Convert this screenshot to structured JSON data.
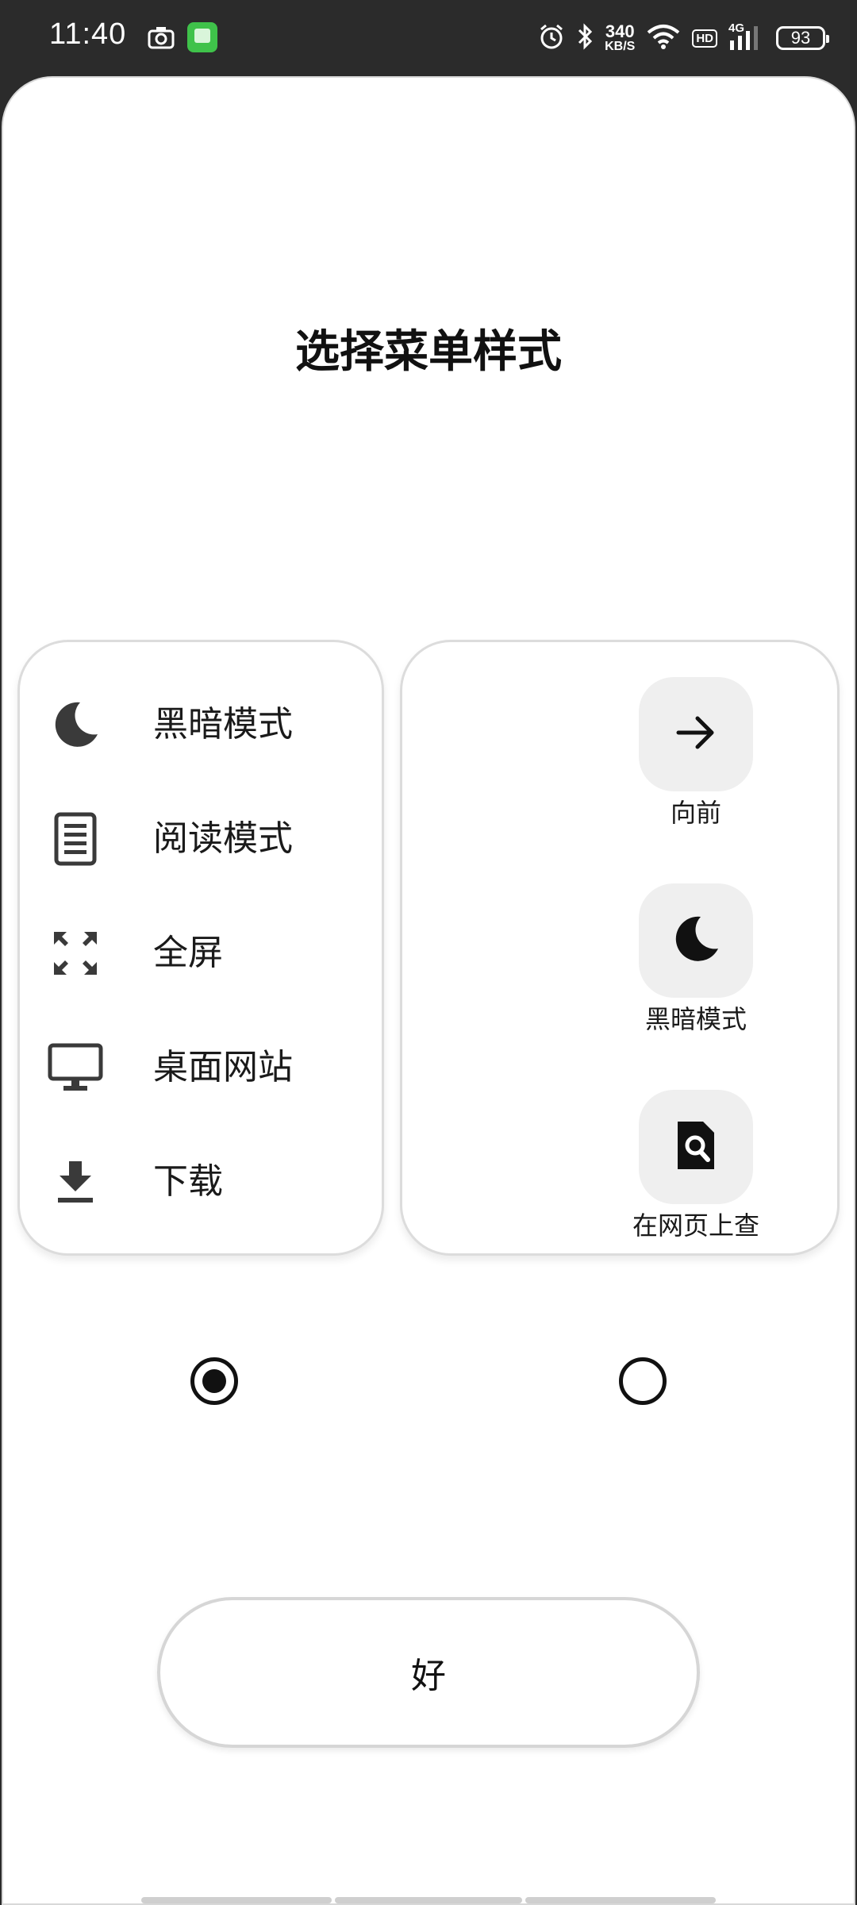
{
  "status_bar": {
    "time": "11:40",
    "net_speed_value": "340",
    "net_speed_unit": "KB/S",
    "hd_label": "HD",
    "network_type": "4G",
    "battery_level": "93"
  },
  "dialog": {
    "title": "选择菜单样式",
    "list_style": {
      "items": [
        {
          "label": "黑暗模式",
          "icon": "moon-icon"
        },
        {
          "label": "阅读模式",
          "icon": "reading-document-icon"
        },
        {
          "label": "全屏",
          "icon": "fullscreen-icon"
        },
        {
          "label": "桌面网站",
          "icon": "desktop-monitor-icon"
        },
        {
          "label": "下载",
          "icon": "download-icon"
        }
      ]
    },
    "grid_style": {
      "items": [
        {
          "label": "向前",
          "icon": "arrow-forward-icon"
        },
        {
          "label": "黑暗模式",
          "icon": "moon-icon"
        },
        {
          "label": "在网页上查",
          "icon": "find-in-page-icon"
        }
      ]
    },
    "selected_style": "list",
    "ok_label": "好"
  },
  "colors": {
    "status_bar_bg": "#2b2b2b",
    "sheet_bg": "#ffffff",
    "tile_bg": "#efefef",
    "text": "#111111"
  }
}
